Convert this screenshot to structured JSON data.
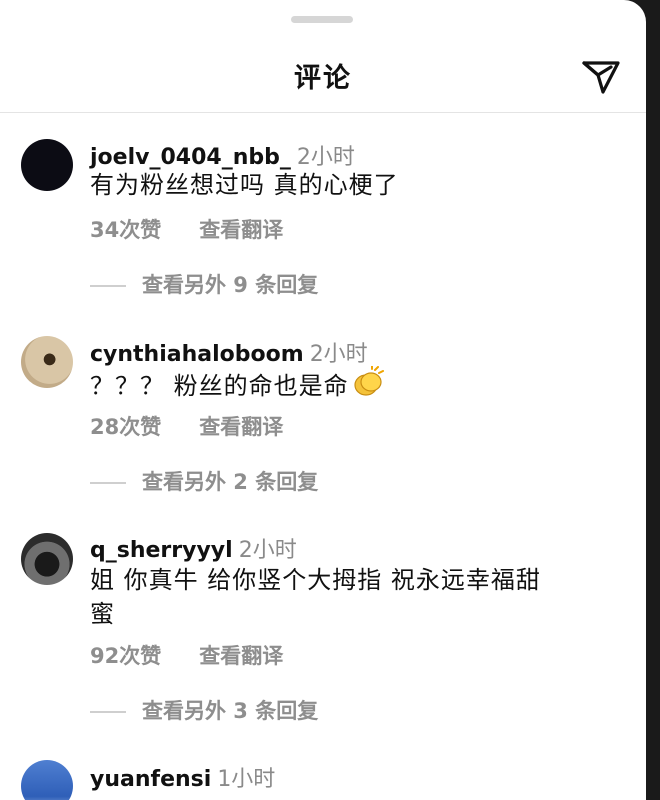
{
  "header": {
    "title": "评论",
    "grabber": "drag-handle",
    "send_icon": "send-icon"
  },
  "comments": [
    {
      "username": "joelv_0404_nbb_",
      "time": "2小时",
      "text": "有为粉丝想过吗 真的心梗了",
      "likes": "34次赞",
      "translate": "查看翻译",
      "replies": "查看另外 9 条回复"
    },
    {
      "username": "cynthiahaloboom",
      "time": "2小时",
      "text": "？？？ 粉丝的命也是命",
      "emoji": "clapping-hands",
      "likes": "28次赞",
      "translate": "查看翻译",
      "replies": "查看另外 2 条回复"
    },
    {
      "username": "q_sherryyyl",
      "time": "2小时",
      "text": "姐 你真牛 给你竖个大拇指 祝永远幸福甜蜜",
      "likes": "92次赞",
      "translate": "查看翻译",
      "replies": "查看另外 3 条回复"
    },
    {
      "username": "yuanfensi",
      "time": "1小时"
    }
  ]
}
